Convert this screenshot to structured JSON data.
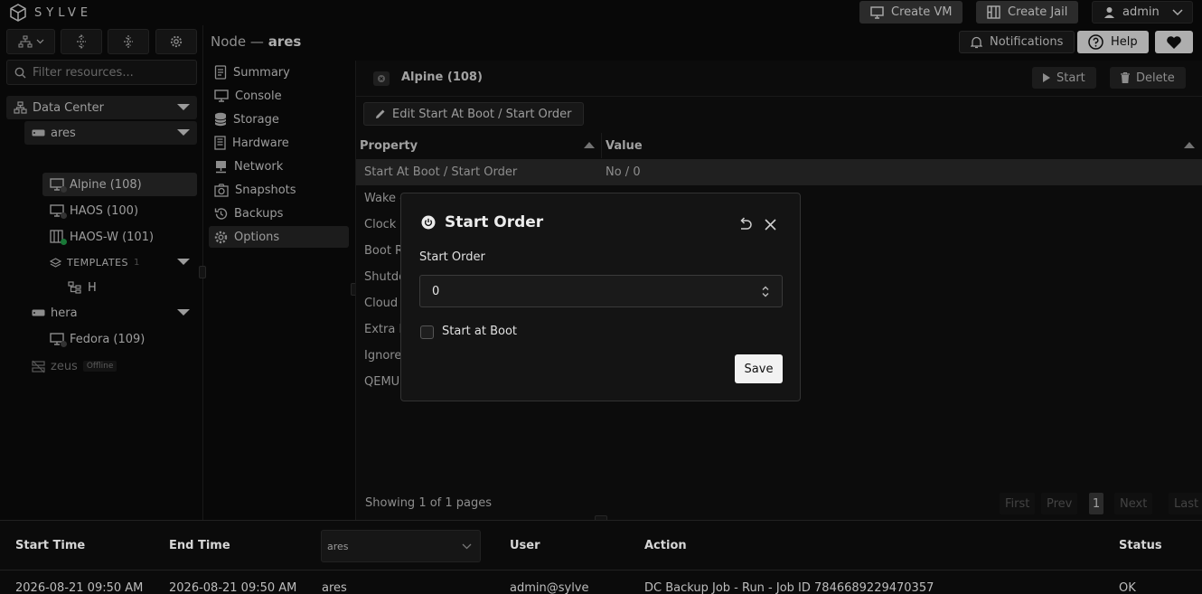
{
  "app": {
    "brand": "SYLVE"
  },
  "topbar": {
    "create_vm": "Create VM",
    "create_jail": "Create Jail",
    "admin": "admin",
    "notifications": "Notifications",
    "help": "Help"
  },
  "sidebar": {
    "filter_placeholder": "Filter resources...",
    "datacenter": "Data Center",
    "nodes": [
      {
        "name": "ares"
      },
      {
        "name": "hera"
      },
      {
        "name": "zeus",
        "badge": "Offline"
      }
    ],
    "ares_items": [
      "Alpine (108)",
      "HAOS (100)",
      "HAOS-W (101)"
    ],
    "templates_label": "TEMPLATES",
    "templates_count": "1",
    "template_item": "H",
    "hera_items": [
      "Fedora (109)"
    ]
  },
  "node_header": {
    "prefix": "Node — ",
    "name": "ares"
  },
  "nav": [
    "Summary",
    "Console",
    "Storage",
    "Hardware",
    "Network",
    "Snapshots",
    "Backups",
    "Options"
  ],
  "main": {
    "vm_title": "Alpine (108)",
    "start": "Start",
    "delete": "Delete",
    "edit_button": "Edit Start At Boot / Start Order",
    "columns": {
      "property": "Property",
      "value": "Value"
    },
    "rows": [
      {
        "property": "Start At Boot / Start Order",
        "value": "No / 0"
      },
      {
        "property": "Wake on LAN",
        "value": ""
      },
      {
        "property": "Clock Offset",
        "value": ""
      },
      {
        "property": "Boot ROM",
        "value": ""
      },
      {
        "property": "Shutdown",
        "value": ""
      },
      {
        "property": "Cloud Init",
        "value": ""
      },
      {
        "property": "Extra BHyve",
        "value": ""
      },
      {
        "property": "Ignore",
        "value": ""
      },
      {
        "property": "QEMU",
        "value": ""
      }
    ],
    "footer": "Showing 1 of 1 pages",
    "pagination": {
      "first": "First",
      "prev": "Prev",
      "page": "1",
      "next": "Next",
      "last": "Last"
    }
  },
  "dialog": {
    "title": "Start Order",
    "field_label": "Start Order",
    "field_value": "0",
    "checkbox_label": "Start at Boot",
    "save": "Save"
  },
  "log": {
    "headers": {
      "start": "Start Time",
      "end": "End Time",
      "node_filter": "ares",
      "user": "User",
      "action": "Action",
      "status": "Status"
    },
    "row": {
      "start": "2026-08-21 09:50 AM",
      "end": "2026-08-21 09:50 AM",
      "node": "ares",
      "user": "admin@sylve",
      "action": "DC Backup Job - Run - Job ID 7846689229470357",
      "status": "OK"
    }
  }
}
